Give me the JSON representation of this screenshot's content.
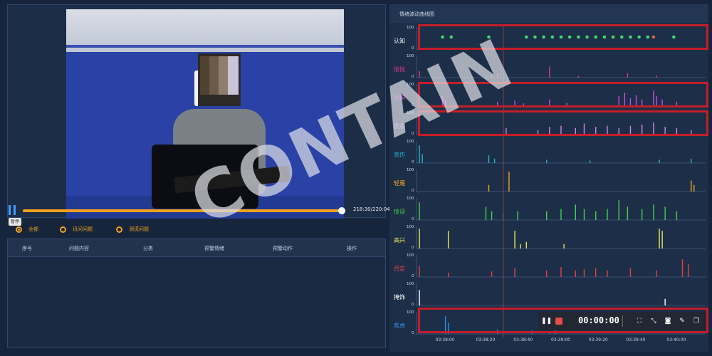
{
  "player": {
    "time_text": "218:30/220:04",
    "progress": 0.992,
    "tooltip": "暂停",
    "clock_digits": "24",
    "colors": {
      "progress": "#f0a21c",
      "pause": "#3ba0ff"
    }
  },
  "filters": [
    {
      "label": "全部",
      "selected": true
    },
    {
      "label": "讯问问题",
      "selected": false
    },
    {
      "label": "测谎问题",
      "selected": false
    }
  ],
  "question_table": {
    "headers": [
      "序号",
      "问题内容",
      "分类",
      "预警情绪",
      "预警动作",
      "操作"
    ],
    "rows": []
  },
  "chart_panel": {
    "title": "情绪波动曲线图",
    "x_ticks": [
      "03:38:00",
      "03:38:20",
      "03:38:40",
      "03:39:00",
      "03:39:20",
      "03:39:40",
      "03:40:00"
    ],
    "toolbar": {
      "timer": "00:00:00"
    },
    "watermark": "CONTAIN"
  },
  "chart_data": {
    "type": "line",
    "x_ticks": [
      "03:38:00",
      "03:38:20",
      "03:38:40",
      "03:39:00",
      "03:39:20",
      "03:39:40",
      "03:40:00"
    ],
    "series": [
      {
        "name": "认知",
        "color": "#ffffff",
        "ymax": "100",
        "ymin": "0",
        "type": "dots",
        "points": [
          0.09,
          0.12,
          0.25,
          0.38,
          0.41,
          0.44,
          0.47,
          0.5,
          0.53,
          0.56,
          0.59,
          0.62,
          0.65,
          0.68,
          0.71,
          0.74,
          0.77,
          0.8,
          0.82,
          0.89
        ]
      },
      {
        "name": "愉悦",
        "color": "#d93a8d",
        "ymax": "100",
        "ymin": "0",
        "spikes": [
          [
            0.01,
            0.3
          ],
          [
            0.26,
            0.15
          ],
          [
            0.28,
            0.2
          ],
          [
            0.46,
            0.5
          ],
          [
            0.56,
            0.08
          ],
          [
            0.73,
            0.2
          ],
          [
            0.83,
            0.1
          ]
        ]
      },
      {
        "name": "恐惧",
        "color": "#c84ce0",
        "ymax": "100",
        "ymin": "0",
        "spikes": [
          [
            0.09,
            0.45
          ],
          [
            0.1,
            0.3
          ],
          [
            0.28,
            0.2
          ],
          [
            0.34,
            0.25
          ],
          [
            0.37,
            0.12
          ],
          [
            0.46,
            0.3
          ],
          [
            0.52,
            0.15
          ],
          [
            0.7,
            0.45
          ],
          [
            0.72,
            0.6
          ],
          [
            0.74,
            0.35
          ],
          [
            0.76,
            0.5
          ],
          [
            0.78,
            0.3
          ],
          [
            0.82,
            0.7
          ],
          [
            0.83,
            0.45
          ],
          [
            0.85,
            0.3
          ],
          [
            0.9,
            0.2
          ]
        ]
      },
      {
        "name": "厌恶",
        "color": "#cf88e8",
        "ymax": "100",
        "ymin": "0",
        "spikes": [
          [
            0.31,
            0.3
          ],
          [
            0.42,
            0.2
          ],
          [
            0.46,
            0.35
          ],
          [
            0.5,
            0.4
          ],
          [
            0.55,
            0.3
          ],
          [
            0.58,
            0.5
          ],
          [
            0.62,
            0.35
          ],
          [
            0.66,
            0.4
          ],
          [
            0.7,
            0.3
          ],
          [
            0.74,
            0.4
          ],
          [
            0.78,
            0.45
          ],
          [
            0.82,
            0.55
          ],
          [
            0.86,
            0.35
          ],
          [
            0.9,
            0.3
          ],
          [
            0.95,
            0.2
          ]
        ]
      },
      {
        "name": "悲伤",
        "color": "#25b7c9",
        "ymax": "100",
        "ymin": "0",
        "spikes": [
          [
            0.01,
            0.8
          ],
          [
            0.02,
            0.4
          ],
          [
            0.25,
            0.35
          ],
          [
            0.27,
            0.2
          ],
          [
            0.45,
            0.15
          ],
          [
            0.6,
            0.12
          ],
          [
            0.84,
            0.15
          ],
          [
            0.95,
            0.2
          ]
        ]
      },
      {
        "name": "轻蔑",
        "color": "#f2a51e",
        "ymax": "100",
        "ymin": "0",
        "spikes": [
          [
            0.25,
            0.3
          ],
          [
            0.32,
            0.9
          ],
          [
            0.95,
            0.5
          ],
          [
            0.96,
            0.3
          ]
        ]
      },
      {
        "name": "惊讶",
        "color": "#46d24a",
        "ymax": "100",
        "ymin": "0",
        "spikes": [
          [
            0.01,
            0.8
          ],
          [
            0.24,
            0.6
          ],
          [
            0.26,
            0.4
          ],
          [
            0.3,
            0.3
          ],
          [
            0.35,
            0.4
          ],
          [
            0.45,
            0.4
          ],
          [
            0.5,
            0.5
          ],
          [
            0.55,
            0.7
          ],
          [
            0.58,
            0.5
          ],
          [
            0.62,
            0.4
          ],
          [
            0.66,
            0.5
          ],
          [
            0.7,
            0.9
          ],
          [
            0.73,
            0.6
          ],
          [
            0.78,
            0.5
          ],
          [
            0.82,
            0.7
          ],
          [
            0.86,
            0.6
          ],
          [
            0.9,
            0.4
          ]
        ]
      },
      {
        "name": "高兴",
        "color": "#e7e458",
        "ymax": "100",
        "ymin": "0",
        "spikes": [
          [
            0.01,
            0.9
          ],
          [
            0.11,
            0.8
          ],
          [
            0.34,
            0.8
          ],
          [
            0.36,
            0.2
          ],
          [
            0.38,
            0.3
          ],
          [
            0.51,
            0.2
          ],
          [
            0.84,
            0.9
          ],
          [
            0.85,
            0.8
          ]
        ]
      },
      {
        "name": "否定",
        "color": "#e5433a",
        "ymax": "100",
        "ymin": "0",
        "spikes": [
          [
            0.01,
            0.5
          ],
          [
            0.11,
            0.2
          ],
          [
            0.26,
            0.25
          ],
          [
            0.34,
            0.4
          ],
          [
            0.45,
            0.3
          ],
          [
            0.5,
            0.45
          ],
          [
            0.55,
            0.3
          ],
          [
            0.58,
            0.35
          ],
          [
            0.62,
            0.4
          ],
          [
            0.66,
            0.3
          ],
          [
            0.74,
            0.4
          ],
          [
            0.83,
            0.3
          ],
          [
            0.92,
            0.8
          ],
          [
            0.94,
            0.6
          ]
        ]
      },
      {
        "name": "掩饰",
        "color": "#ffffff",
        "ymax": "100",
        "ymin": "0",
        "spikes": [
          [
            0.01,
            0.7
          ],
          [
            0.86,
            0.3
          ]
        ]
      },
      {
        "name": "焦虑",
        "color": "#2d92e8",
        "ymax": "100",
        "ymin": "0",
        "spikes": [
          [
            0.1,
            0.8
          ],
          [
            0.11,
            0.5
          ],
          [
            0.28,
            0.2
          ],
          [
            0.4,
            0.15
          ],
          [
            0.46,
            0.1
          ],
          [
            0.48,
            0.2
          ]
        ]
      }
    ]
  }
}
